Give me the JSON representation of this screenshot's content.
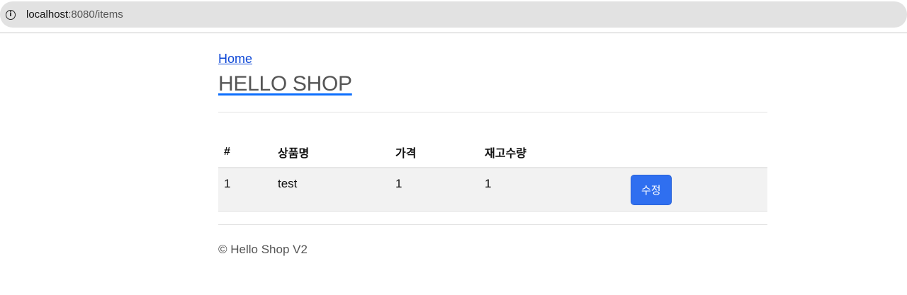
{
  "browser": {
    "url_host": "localhost",
    "url_rest": ":8080/items"
  },
  "nav": {
    "home_label": "Home",
    "title": "HELLO SHOP"
  },
  "table": {
    "headers": [
      "#",
      "상품명",
      "가격",
      "재고수량"
    ],
    "rows": [
      {
        "id": "1",
        "name": "test",
        "price": "1",
        "stock": "1",
        "action": "수정"
      }
    ]
  },
  "footer": {
    "text": "© Hello Shop V2"
  },
  "colors": {
    "primary_button": "#2f6ff0",
    "link": "#0d47d6"
  }
}
